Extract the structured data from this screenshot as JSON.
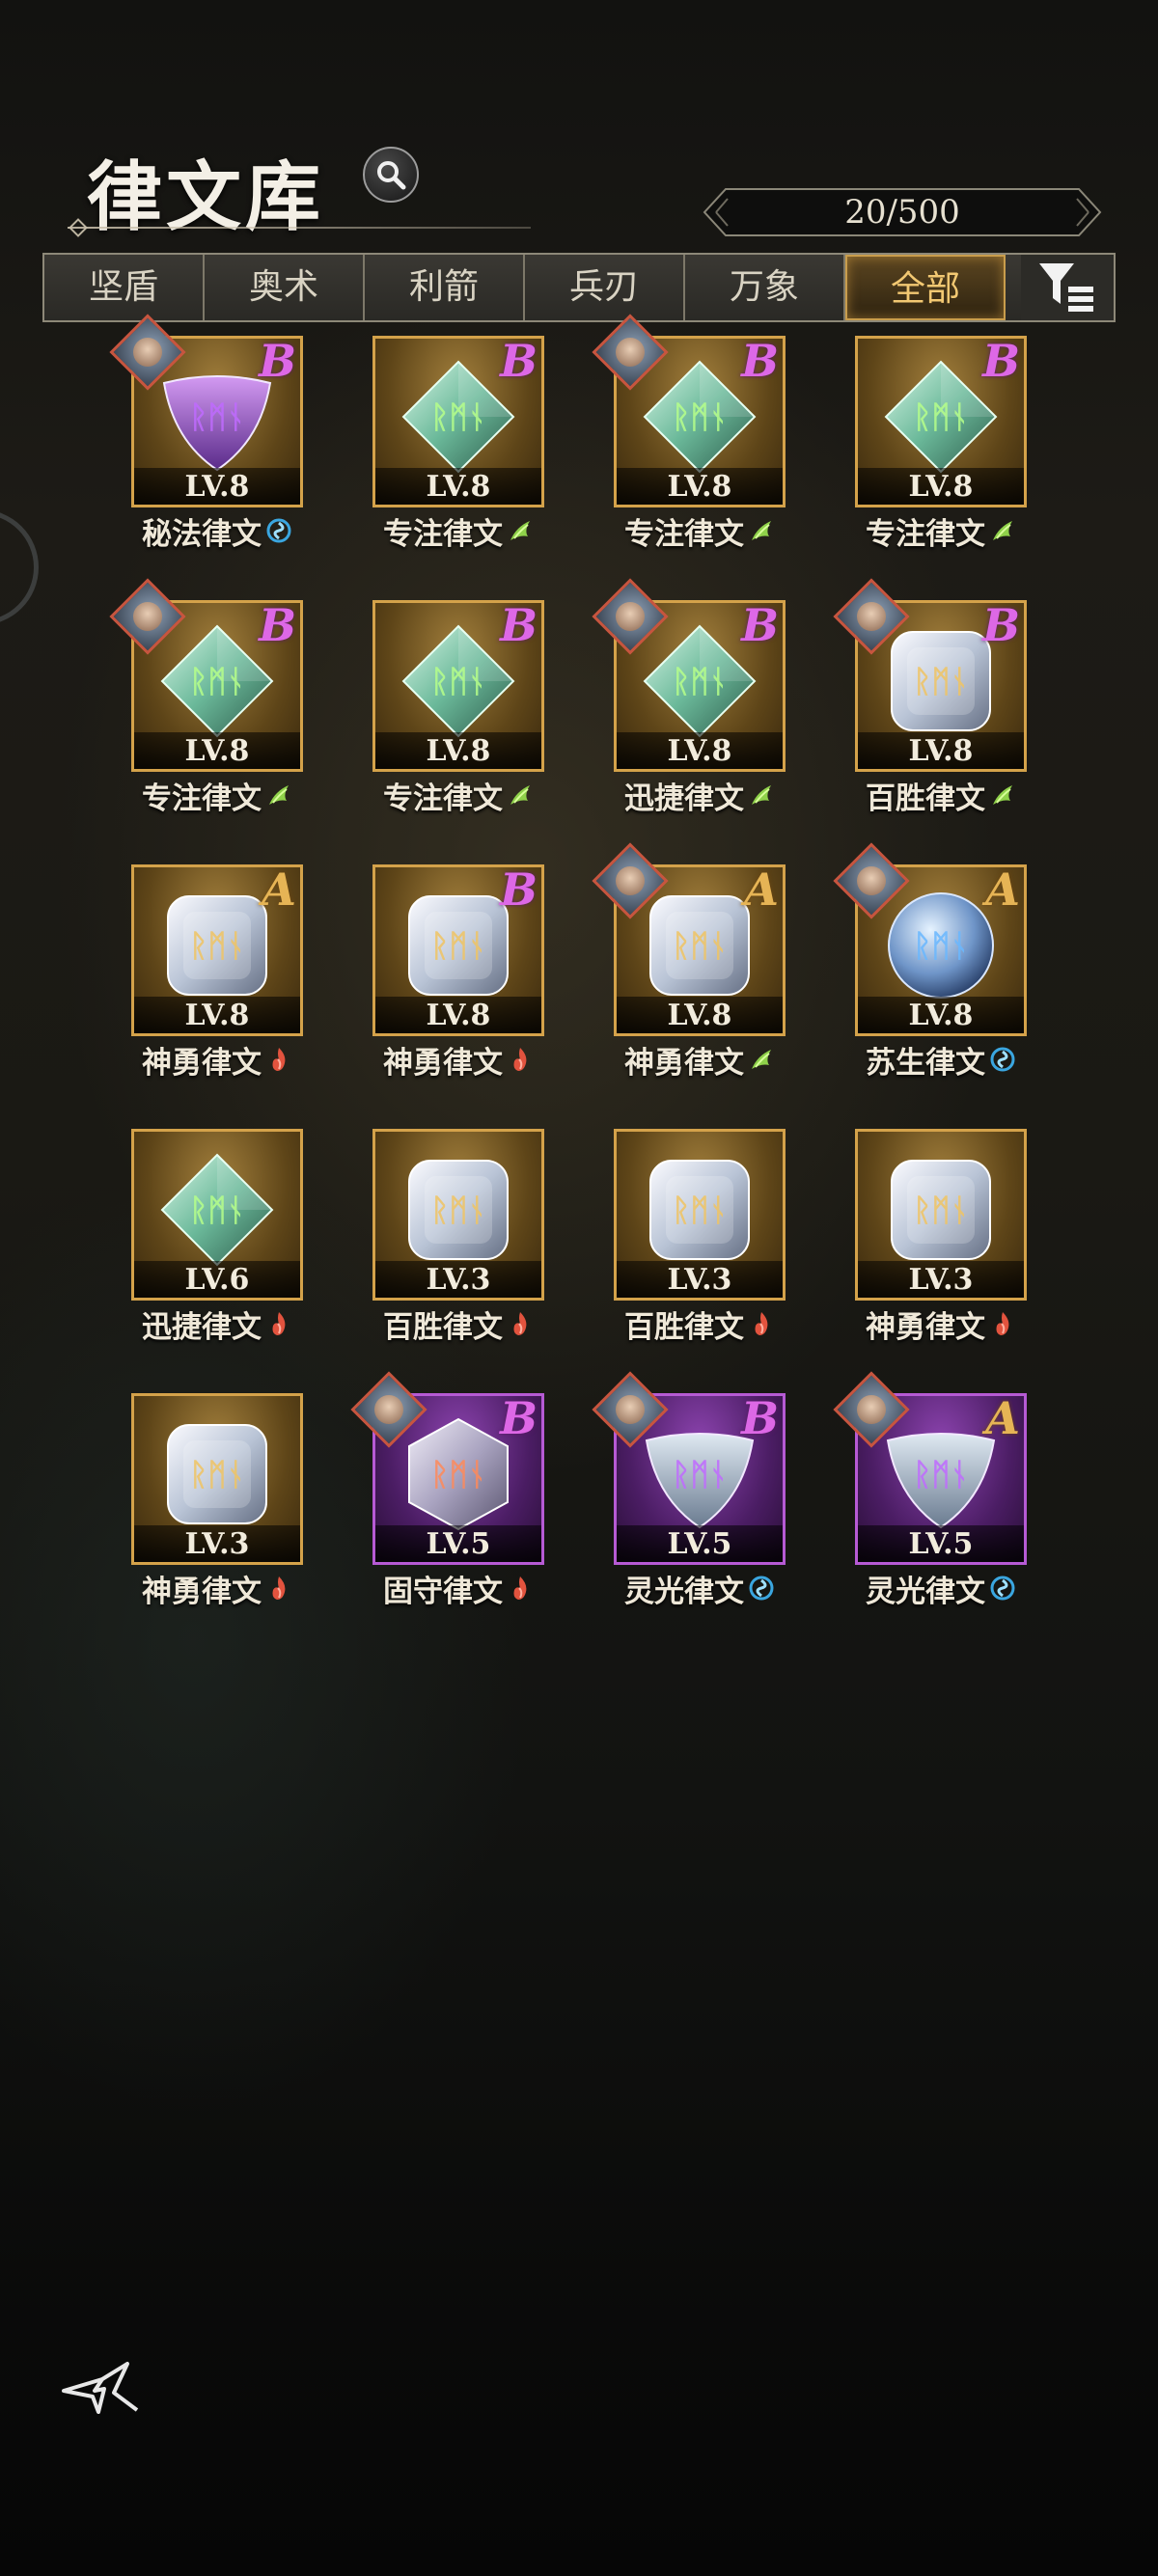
{
  "header": {
    "title": "律文库",
    "count": "20/500"
  },
  "tabs": [
    {
      "label": "坚盾",
      "active": false
    },
    {
      "label": "奥术",
      "active": false
    },
    {
      "label": "利箭",
      "active": false
    },
    {
      "label": "兵刃",
      "active": false
    },
    {
      "label": "万象",
      "active": false
    },
    {
      "label": "全部",
      "active": true
    }
  ],
  "colors": {
    "gold_frame": "#d4a24a",
    "purple_frame": "#b65ad4",
    "grade_b": "#dd68e6",
    "grade_a": "#e6b455",
    "element_wind": "#8fd14a",
    "element_water": "#3aa6e0",
    "element_fire": "#e2533e"
  },
  "runes": [
    {
      "name": "秘法律文",
      "level": "LV.8",
      "grade": "B",
      "frame": "gold",
      "gem": "triangle-purple",
      "element": "water",
      "portrait": true
    },
    {
      "name": "专注律文",
      "level": "LV.8",
      "grade": "B",
      "frame": "gold",
      "gem": "diamond-green",
      "element": "wind",
      "portrait": false
    },
    {
      "name": "专注律文",
      "level": "LV.8",
      "grade": "B",
      "frame": "gold",
      "gem": "diamond-green",
      "element": "wind",
      "portrait": true
    },
    {
      "name": "专注律文",
      "level": "LV.8",
      "grade": "B",
      "frame": "gold",
      "gem": "diamond-green",
      "element": "wind",
      "portrait": false
    },
    {
      "name": "专注律文",
      "level": "LV.8",
      "grade": "B",
      "frame": "gold",
      "gem": "diamond-green",
      "element": "wind",
      "portrait": true
    },
    {
      "name": "专注律文",
      "level": "LV.8",
      "grade": "B",
      "frame": "gold",
      "gem": "diamond-green",
      "element": "wind",
      "portrait": false
    },
    {
      "name": "迅捷律文",
      "level": "LV.8",
      "grade": "B",
      "frame": "gold",
      "gem": "diamond-green",
      "element": "wind",
      "portrait": true
    },
    {
      "name": "百胜律文",
      "level": "LV.8",
      "grade": "B",
      "frame": "gold",
      "gem": "cube-crystal",
      "element": "wind",
      "portrait": true
    },
    {
      "name": "神勇律文",
      "level": "LV.8",
      "grade": "A",
      "frame": "gold",
      "gem": "cube-crystal",
      "element": "fire",
      "portrait": false
    },
    {
      "name": "神勇律文",
      "level": "LV.8",
      "grade": "B",
      "frame": "gold",
      "gem": "cube-crystal",
      "element": "fire",
      "portrait": false
    },
    {
      "name": "神勇律文",
      "level": "LV.8",
      "grade": "A",
      "frame": "gold",
      "gem": "cube-crystal",
      "element": "wind",
      "portrait": true
    },
    {
      "name": "苏生律文",
      "level": "LV.8",
      "grade": "A",
      "frame": "gold",
      "gem": "sphere-blue",
      "element": "water",
      "portrait": true
    },
    {
      "name": "迅捷律文",
      "level": "LV.6",
      "grade": "",
      "frame": "gold",
      "gem": "diamond-green",
      "element": "fire",
      "portrait": false
    },
    {
      "name": "百胜律文",
      "level": "LV.3",
      "grade": "",
      "frame": "gold",
      "gem": "cube-crystal",
      "element": "fire",
      "portrait": false
    },
    {
      "name": "百胜律文",
      "level": "LV.3",
      "grade": "",
      "frame": "gold",
      "gem": "cube-crystal",
      "element": "fire",
      "portrait": false
    },
    {
      "name": "神勇律文",
      "level": "LV.3",
      "grade": "",
      "frame": "gold",
      "gem": "cube-crystal",
      "element": "fire",
      "portrait": false
    },
    {
      "name": "神勇律文",
      "level": "LV.3",
      "grade": "",
      "frame": "gold",
      "gem": "cube-crystal",
      "element": "fire",
      "portrait": false
    },
    {
      "name": "固守律文",
      "level": "LV.5",
      "grade": "B",
      "frame": "purple",
      "gem": "hexagon-crystal",
      "element": "fire",
      "portrait": true
    },
    {
      "name": "灵光律文",
      "level": "LV.5",
      "grade": "B",
      "frame": "purple",
      "gem": "triangle-crystal",
      "element": "water",
      "portrait": true
    },
    {
      "name": "灵光律文",
      "level": "LV.5",
      "grade": "A",
      "frame": "purple",
      "gem": "triangle-crystal",
      "element": "water",
      "portrait": true
    }
  ],
  "icons": {
    "search": "magnifier-icon",
    "filter": "funnel-list-icon",
    "back": "back-arrow-icon"
  }
}
